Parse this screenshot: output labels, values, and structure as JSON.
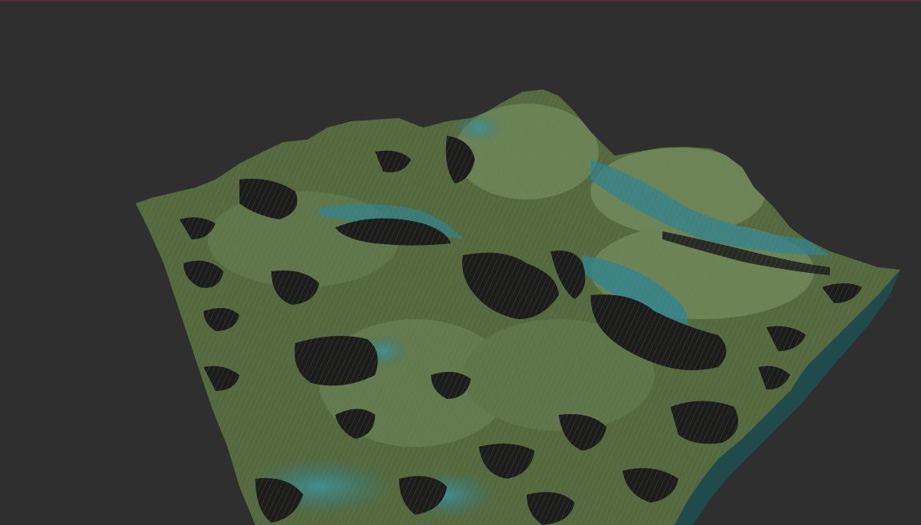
{
  "scene": {
    "type": "3d-terrain-heightmap-render",
    "background_color": "#2f2f2f",
    "top_accent_color": "#5a2a36",
    "palette": {
      "grass": "#5b7048",
      "grass_light": "#6f8558",
      "grass_dark": "#3f4f33",
      "water": "#2b7a86",
      "water_light": "#3a95a0",
      "shadow": "#1c1c1c",
      "side_face": "#1f4b4d"
    }
  }
}
